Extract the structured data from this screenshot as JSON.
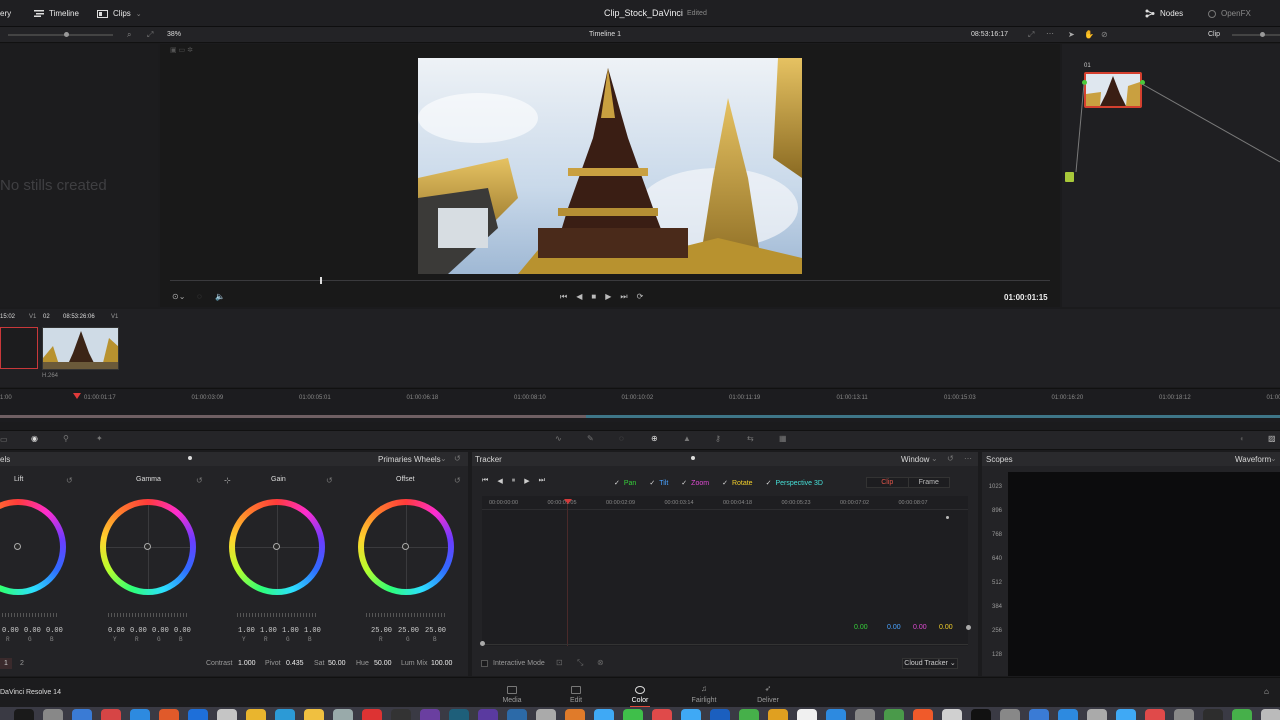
{
  "topbar": {
    "gallery_label": "ery",
    "timeline_label": "Timeline",
    "clips_label": "Clips",
    "project_title": "Clip_Stock_DaVinci",
    "project_status": "Edited",
    "nodes_label": "Nodes",
    "openfx_label": "OpenFX"
  },
  "viewer_toolbar": {
    "zoom": "38%",
    "timeline_name": "Timeline 1",
    "timecode": "08:53:16:17",
    "mode": "Clip"
  },
  "gallery": {
    "empty_text": "No stills created"
  },
  "viewer": {
    "timecode": "01:00:01:15",
    "scrub_position": 0.17
  },
  "node_graph": {
    "node_label": "01"
  },
  "clip_strip": {
    "clips": [
      {
        "timecode": "15:02",
        "track": "V1",
        "codec": ""
      },
      {
        "index": "02",
        "timecode": "08:53:26:06",
        "track": "V1",
        "codec": "H.264"
      }
    ]
  },
  "mini_timeline": {
    "ticks": [
      "1:00",
      "01:00:01:17",
      "01:00:03:09",
      "01:00:05:01",
      "01:00:06:18",
      "01:00:08:10",
      "01:00:10:02",
      "01:00:11:19",
      "01:00:13:11",
      "01:00:15:03",
      "01:00:16:20",
      "01:00:18:12",
      "01:00:2"
    ]
  },
  "primaries": {
    "left_label": "els",
    "mode_label": "Primaries Wheels",
    "wheels": [
      {
        "name": "Lift",
        "values": [
          "0.00",
          "0.00",
          "0.00",
          "0.00"
        ],
        "channels": [
          "Y",
          "R",
          "G",
          "B"
        ]
      },
      {
        "name": "Gamma",
        "values": [
          "0.00",
          "0.00",
          "0.00",
          "0.00"
        ],
        "channels": [
          "Y",
          "R",
          "G",
          "B"
        ]
      },
      {
        "name": "Gain",
        "values": [
          "1.00",
          "1.00",
          "1.00",
          "1.00"
        ],
        "channels": [
          "Y",
          "R",
          "G",
          "B"
        ]
      },
      {
        "name": "Offset",
        "values": [
          "25.00",
          "25.00",
          "25.00"
        ],
        "channels": [
          "R",
          "G",
          "B"
        ]
      }
    ],
    "page_numbers": [
      "1",
      "2"
    ],
    "contrast_label": "Contrast",
    "contrast": "1.000",
    "pivot_label": "Pivot",
    "pivot": "0.435",
    "sat_label": "Sat",
    "sat": "50.00",
    "hue_label": "Hue",
    "hue": "50.00",
    "lummix_label": "Lum Mix",
    "lummix": "100.00"
  },
  "tracker": {
    "title": "Tracker",
    "window_label": "Window",
    "checks": [
      {
        "label": "Pan",
        "color": "#36d13a"
      },
      {
        "label": "Tilt",
        "color": "#4aa3ff"
      },
      {
        "label": "Zoom",
        "color": "#e04ad4"
      },
      {
        "label": "Rotate",
        "color": "#f2cf2b"
      },
      {
        "label": "Perspective 3D",
        "color": "#46e0d8"
      }
    ],
    "clip_label": "Clip",
    "frame_label": "Frame",
    "ruler": [
      "00:00:00:00",
      "00:00:01:05",
      "00:00:02:09",
      "00:00:03:14",
      "00:00:04:18",
      "00:00:05:23",
      "00:00:07:02",
      "00:00:08:07"
    ],
    "readouts": [
      {
        "v": "0.00",
        "color": "#36d13a"
      },
      {
        "v": "0.00",
        "color": "#4aa3ff"
      },
      {
        "v": "0.00",
        "color": "#e04ad4"
      },
      {
        "v": "0.00",
        "color": "#f2cf2b"
      }
    ],
    "interactive_label": "Interactive Mode",
    "cloud_tracker": "Cloud Tracker"
  },
  "scopes": {
    "title": "Scopes",
    "mode": "Waveform",
    "scale": [
      "1023",
      "896",
      "768",
      "640",
      "512",
      "384",
      "256",
      "128"
    ]
  },
  "bottom": {
    "app_name": "DaVinci Resolve 14",
    "pages": [
      "Media",
      "Edit",
      "Color",
      "Fairlight",
      "Deliver"
    ],
    "active_page": "Color"
  }
}
